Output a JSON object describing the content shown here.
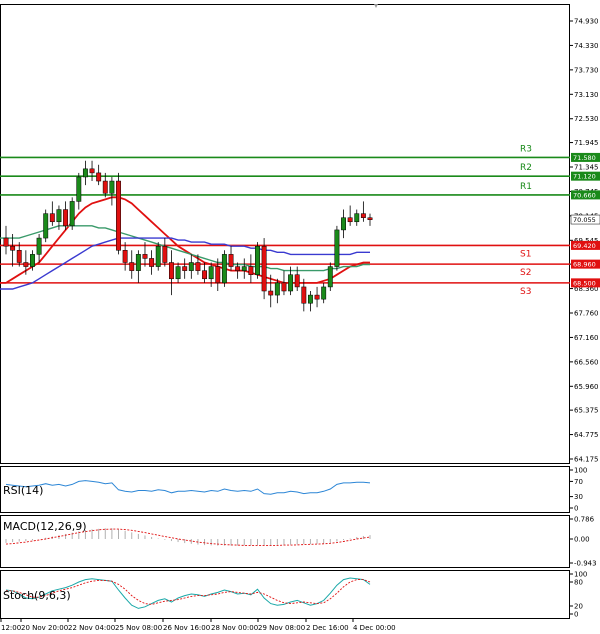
{
  "chart_data": [
    {
      "type": "candlestick",
      "panel": "price",
      "y_ticks": [
        "74.930",
        "74.330",
        "73.730",
        "73.130",
        "72.530",
        "71.945",
        "71.345",
        "70.745",
        "70.145",
        "69.545",
        "68.960",
        "68.360",
        "67.760",
        "67.160",
        "66.560",
        "65.960",
        "65.375",
        "64.775",
        "64.175"
      ],
      "ylim": [
        64.175,
        75.1
      ],
      "levels": [
        {
          "name": "R3",
          "value": 71.58,
          "label": "71.580",
          "color": "#1a8a1a"
        },
        {
          "name": "R2",
          "value": 71.12,
          "label": "71.120",
          "color": "#1a8a1a"
        },
        {
          "name": "R1",
          "value": 70.66,
          "label": "70.660",
          "color": "#1a8a1a"
        },
        {
          "name": "S1",
          "value": 69.42,
          "label": "69.420",
          "color": "#e01010"
        },
        {
          "name": "S2",
          "value": 68.96,
          "label": "68.960",
          "color": "#e01010"
        },
        {
          "name": "S3",
          "value": 68.5,
          "label": "68.500",
          "color": "#e01010"
        }
      ],
      "last_price": {
        "value": 70.055,
        "label": "70.055"
      },
      "candles": [
        [
          69.6,
          69.9,
          69.2,
          69.4
        ],
        [
          69.4,
          69.7,
          68.9,
          69.3
        ],
        [
          69.3,
          69.5,
          68.9,
          69.0
        ],
        [
          69.0,
          69.3,
          68.7,
          68.9
        ],
        [
          68.9,
          69.3,
          68.8,
          69.2
        ],
        [
          69.2,
          69.7,
          69.0,
          69.6
        ],
        [
          69.6,
          70.3,
          69.5,
          70.2
        ],
        [
          70.2,
          70.5,
          69.9,
          70.0
        ],
        [
          70.0,
          70.4,
          69.8,
          70.3
        ],
        [
          70.3,
          70.5,
          69.8,
          69.9
        ],
        [
          69.9,
          70.6,
          69.8,
          70.5
        ],
        [
          70.5,
          71.2,
          70.3,
          71.1
        ],
        [
          71.1,
          71.5,
          70.9,
          71.3
        ],
        [
          71.3,
          71.5,
          71.0,
          71.2
        ],
        [
          71.2,
          71.4,
          70.9,
          71.0
        ],
        [
          71.0,
          71.2,
          70.6,
          70.7
        ],
        [
          70.7,
          71.1,
          70.4,
          71.0
        ],
        [
          71.0,
          71.2,
          69.2,
          69.3
        ],
        [
          69.3,
          69.5,
          68.8,
          69.0
        ],
        [
          69.0,
          69.3,
          68.6,
          68.8
        ],
        [
          68.8,
          69.3,
          68.5,
          69.2
        ],
        [
          69.2,
          69.5,
          68.9,
          69.1
        ],
        [
          69.1,
          69.3,
          68.7,
          68.9
        ],
        [
          68.9,
          69.5,
          68.8,
          69.4
        ],
        [
          69.4,
          69.6,
          68.9,
          69.0
        ],
        [
          69.0,
          69.3,
          68.2,
          68.6
        ],
        [
          68.6,
          69.0,
          68.5,
          68.9
        ],
        [
          68.9,
          69.1,
          68.6,
          68.8
        ],
        [
          68.8,
          69.2,
          68.6,
          69.0
        ],
        [
          69.0,
          69.2,
          68.7,
          68.8
        ],
        [
          68.8,
          69.0,
          68.5,
          68.6
        ],
        [
          68.6,
          69.0,
          68.4,
          68.9
        ],
        [
          68.9,
          69.1,
          68.3,
          68.5
        ],
        [
          68.5,
          69.3,
          68.4,
          69.2
        ],
        [
          69.2,
          69.4,
          68.8,
          68.9
        ],
        [
          68.9,
          69.0,
          68.6,
          68.8
        ],
        [
          68.8,
          69.1,
          68.6,
          68.9
        ],
        [
          68.9,
          69.2,
          68.5,
          68.7
        ],
        [
          68.7,
          69.5,
          68.6,
          69.4
        ],
        [
          69.4,
          69.6,
          68.1,
          68.3
        ],
        [
          68.3,
          68.7,
          67.9,
          68.2
        ],
        [
          68.2,
          68.6,
          68.0,
          68.5
        ],
        [
          68.5,
          68.8,
          68.2,
          68.3
        ],
        [
          68.3,
          68.9,
          68.2,
          68.7
        ],
        [
          68.7,
          68.9,
          68.3,
          68.4
        ],
        [
          68.4,
          68.6,
          67.8,
          68.0
        ],
        [
          68.0,
          68.3,
          67.8,
          68.2
        ],
        [
          68.2,
          68.4,
          67.9,
          68.1
        ],
        [
          68.1,
          68.5,
          68.0,
          68.4
        ],
        [
          68.4,
          69.0,
          68.3,
          68.9
        ],
        [
          68.9,
          69.9,
          68.8,
          69.8
        ],
        [
          69.8,
          70.3,
          69.6,
          70.1
        ],
        [
          70.1,
          70.4,
          69.9,
          70.0
        ],
        [
          70.0,
          70.3,
          69.9,
          70.2
        ],
        [
          70.2,
          70.5,
          70.0,
          70.1
        ],
        [
          70.1,
          70.2,
          69.9,
          70.05
        ]
      ],
      "moving_averages": [
        {
          "color": "#e01010",
          "values": [
            68.5,
            68.6,
            68.7,
            68.8,
            68.9,
            69.0,
            69.2,
            69.4,
            69.6,
            69.8,
            70.0,
            70.2,
            70.35,
            70.45,
            70.5,
            70.55,
            70.6,
            70.6,
            70.55,
            70.45,
            70.3,
            70.15,
            70.0,
            69.85,
            69.7,
            69.55,
            69.4,
            69.3,
            69.2,
            69.1,
            69.0,
            68.95,
            68.9,
            68.85,
            68.8,
            68.8,
            68.8,
            68.75,
            68.7,
            68.65,
            68.6,
            68.55,
            68.5,
            68.5,
            68.5,
            68.5,
            68.5,
            68.5,
            68.55,
            68.6,
            68.7,
            68.8,
            68.9,
            68.95,
            69.0,
            69.0
          ]
        },
        {
          "color": "#3a9a6a",
          "values": [
            69.6,
            69.6,
            69.6,
            69.65,
            69.7,
            69.75,
            69.8,
            69.85,
            69.9,
            69.9,
            69.9,
            69.9,
            69.9,
            69.9,
            69.85,
            69.85,
            69.8,
            69.75,
            69.7,
            69.65,
            69.6,
            69.55,
            69.5,
            69.45,
            69.4,
            69.35,
            69.3,
            69.25,
            69.2,
            69.15,
            69.1,
            69.05,
            69.0,
            69.0,
            68.95,
            68.95,
            68.95,
            68.9,
            68.9,
            68.9,
            68.85,
            68.85,
            68.8,
            68.8,
            68.8,
            68.8,
            68.8,
            68.8,
            68.8,
            68.85,
            68.85,
            68.9,
            68.9,
            68.9,
            68.95,
            68.95
          ]
        },
        {
          "color": "#3a3ad0",
          "values": [
            68.35,
            68.35,
            68.4,
            68.45,
            68.5,
            68.6,
            68.7,
            68.8,
            68.9,
            69.0,
            69.1,
            69.2,
            69.3,
            69.4,
            69.45,
            69.5,
            69.55,
            69.6,
            69.6,
            69.6,
            69.6,
            69.6,
            69.6,
            69.6,
            69.6,
            69.6,
            69.55,
            69.55,
            69.5,
            69.5,
            69.5,
            69.45,
            69.45,
            69.45,
            69.4,
            69.4,
            69.4,
            69.35,
            69.35,
            69.3,
            69.3,
            69.25,
            69.25,
            69.2,
            69.2,
            69.2,
            69.2,
            69.2,
            69.2,
            69.2,
            69.2,
            69.2,
            69.2,
            69.25,
            69.25,
            69.25
          ]
        }
      ]
    },
    {
      "type": "line",
      "panel": "rsi",
      "name": "RSI(14)",
      "y_ticks": [
        "100",
        "70",
        "30",
        "0"
      ],
      "ylim": [
        0,
        100
      ],
      "values": [
        62,
        60,
        58,
        56,
        58,
        60,
        64,
        60,
        62,
        58,
        62,
        70,
        72,
        70,
        68,
        64,
        66,
        48,
        44,
        42,
        46,
        46,
        44,
        48,
        46,
        40,
        44,
        44,
        46,
        44,
        42,
        46,
        44,
        50,
        46,
        44,
        46,
        44,
        50,
        38,
        36,
        40,
        40,
        44,
        42,
        38,
        40,
        40,
        44,
        50,
        62,
        66,
        66,
        68,
        68,
        66
      ]
    },
    {
      "type": "line",
      "panel": "macd",
      "name": "MACD(12,26,9)",
      "y_ticks": [
        "0.786",
        "0.00",
        "-0.943"
      ],
      "ylim": [
        -0.943,
        0.786
      ],
      "histogram": [
        -0.15,
        -0.12,
        -0.1,
        -0.08,
        -0.05,
        0.0,
        0.05,
        0.1,
        0.15,
        0.2,
        0.25,
        0.3,
        0.35,
        0.38,
        0.4,
        0.42,
        0.42,
        0.38,
        0.32,
        0.26,
        0.2,
        0.14,
        0.08,
        0.02,
        -0.03,
        -0.08,
        -0.12,
        -0.16,
        -0.19,
        -0.22,
        -0.24,
        -0.25,
        -0.26,
        -0.26,
        -0.26,
        -0.26,
        -0.25,
        -0.25,
        -0.24,
        -0.24,
        -0.24,
        -0.23,
        -0.23,
        -0.22,
        -0.21,
        -0.2,
        -0.2,
        -0.19,
        -0.18,
        -0.15,
        -0.1,
        -0.04,
        0.02,
        0.08,
        0.12,
        0.15
      ],
      "signal": [
        -0.2,
        -0.18,
        -0.15,
        -0.12,
        -0.08,
        -0.04,
        0.0,
        0.05,
        0.1,
        0.15,
        0.2,
        0.25,
        0.29,
        0.33,
        0.36,
        0.38,
        0.39,
        0.39,
        0.37,
        0.34,
        0.3,
        0.25,
        0.2,
        0.15,
        0.1,
        0.05,
        0.0,
        -0.04,
        -0.08,
        -0.12,
        -0.15,
        -0.18,
        -0.2,
        -0.22,
        -0.23,
        -0.24,
        -0.25,
        -0.25,
        -0.25,
        -0.25,
        -0.25,
        -0.25,
        -0.24,
        -0.24,
        -0.23,
        -0.22,
        -0.21,
        -0.2,
        -0.19,
        -0.17,
        -0.14,
        -0.1,
        -0.05,
        0.0,
        0.04,
        0.08
      ]
    },
    {
      "type": "line",
      "panel": "stoch",
      "name": "Stoch(9,6,3)",
      "y_ticks": [
        "100",
        "80",
        "20",
        "0"
      ],
      "ylim": [
        0,
        100
      ],
      "k": [
        60,
        58,
        50,
        40,
        38,
        42,
        50,
        58,
        62,
        66,
        72,
        80,
        86,
        88,
        86,
        84,
        82,
        60,
        40,
        22,
        14,
        18,
        26,
        34,
        38,
        30,
        40,
        46,
        50,
        48,
        44,
        50,
        54,
        60,
        56,
        50,
        52,
        48,
        62,
        40,
        26,
        22,
        24,
        30,
        34,
        28,
        22,
        26,
        34,
        52,
        72,
        86,
        90,
        88,
        86,
        74
      ],
      "d": [
        58,
        58,
        54,
        48,
        42,
        42,
        46,
        52,
        58,
        62,
        66,
        72,
        78,
        82,
        84,
        84,
        82,
        74,
        62,
        46,
        34,
        26,
        24,
        28,
        32,
        34,
        36,
        40,
        44,
        46,
        46,
        48,
        50,
        54,
        56,
        54,
        52,
        50,
        54,
        50,
        42,
        34,
        28,
        26,
        28,
        30,
        28,
        26,
        28,
        38,
        52,
        68,
        80,
        86,
        86,
        80
      ]
    }
  ],
  "x_ticks": [
    "12:00",
    "20 Nov 20:00",
    "22 Nov 04:00",
    "25 Nov 08:00",
    "26 Nov 16:00",
    "28 Nov 00:00",
    "29 Nov 08:00",
    "2 Dec 16:00",
    "4 Dec 00:00"
  ],
  "colors": {
    "bull": "#1a8a1a",
    "bear": "#e01010",
    "frame": "#000000",
    "rsi": "#2c86d6",
    "stoch_k": "#1aa8a8",
    "stoch_d": "#e01010"
  }
}
